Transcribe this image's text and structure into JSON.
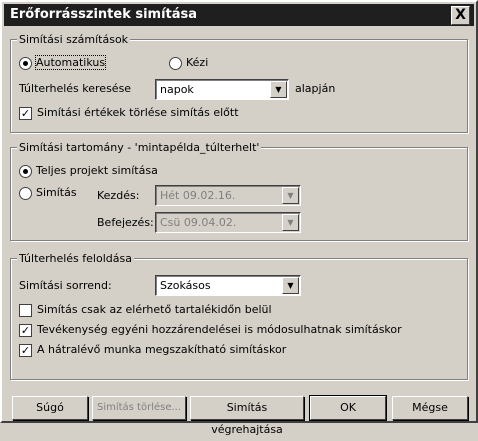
{
  "window": {
    "title": "Erőforrásszintek simítása",
    "close_label": "X"
  },
  "calc_group": {
    "label": "Simítási számítások",
    "auto_label": "Automatikus",
    "manual_label": "Kézi",
    "search_label": "Túlterhelés keresése",
    "search_value": "napok",
    "search_suffix": "alapján",
    "clear_label": "Simítási értékek törlése simítás előtt"
  },
  "range_group": {
    "label": "Simítási tartomány - 'mintapélda_túlterhelt'",
    "full_label": "Teljes projekt simítása",
    "partial_label": "Simítás",
    "start_label": "Kezdés:",
    "start_value": "Hét 09.02.16.",
    "end_label": "Befejezés:",
    "end_value": "Csü 09.04.02."
  },
  "resolve_group": {
    "label": "Túlterhelés feloldása",
    "order_label": "Simítási sorrend:",
    "order_value": "Szokásos",
    "option1": "Simítás csak az elérhető tartalékidőn belül",
    "option2": "Tevékenység egyéni hozzárendelései is módosulhatnak simításkor",
    "option3": "A hátralévő munka megszakítható simításkor"
  },
  "buttons": {
    "help": "Súgó",
    "clear": "Simítás törlése...",
    "run": "Simítás végrehajtása",
    "ok": "OK",
    "cancel": "Mégse"
  },
  "state": {
    "auto_checked": true,
    "clear_checked": true,
    "full_checked": true,
    "option1_checked": false,
    "option2_checked": true,
    "option3_checked": true
  }
}
